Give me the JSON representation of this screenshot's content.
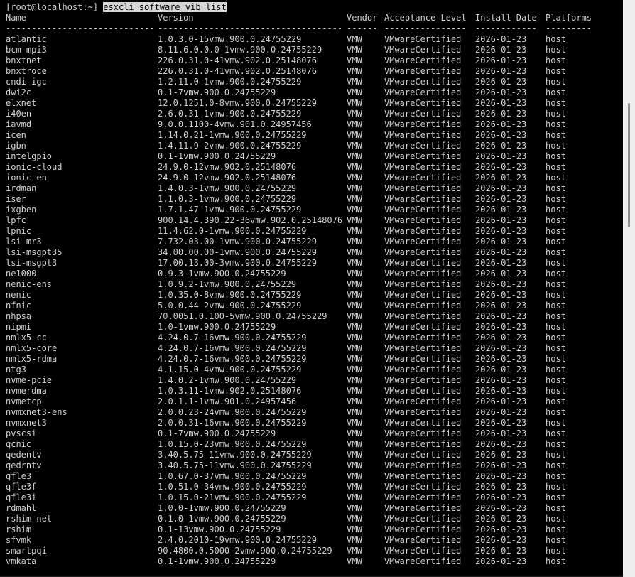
{
  "terminal": {
    "prompt": "[root@localhost:~] ",
    "command": "esxcli software vib list"
  },
  "table": {
    "headers": [
      "Name",
      "Version",
      "Vendor",
      "Acceptance Level",
      "Install Date",
      "Platforms"
    ],
    "separators": [
      "-----------------------------",
      "------------------------------------",
      "------",
      "----------------",
      "------------",
      "---------"
    ],
    "rows": [
      [
        "atlantic",
        "1.0.3.0-15vmw.900.0.24755229",
        "VMW",
        "VMwareCertified",
        "2026-01-23",
        "host"
      ],
      [
        "bcm-mpi3",
        "8.11.6.0.0.0-1vmw.900.0.24755229",
        "VMW",
        "VMwareCertified",
        "2026-01-23",
        "host"
      ],
      [
        "bnxtnet",
        "226.0.31.0-41vmw.902.0.25148076",
        "VMW",
        "VMwareCertified",
        "2026-01-23",
        "host"
      ],
      [
        "bnxtroce",
        "226.0.31.0-41vmw.902.0.25148076",
        "VMW",
        "VMwareCertified",
        "2026-01-23",
        "host"
      ],
      [
        "cndi-igc",
        "1.2.11.0-1vmw.900.0.24755229",
        "VMW",
        "VMwareCertified",
        "2026-01-23",
        "host"
      ],
      [
        "dwi2c",
        "0.1-7vmw.900.0.24755229",
        "VMW",
        "VMwareCertified",
        "2026-01-23",
        "host"
      ],
      [
        "elxnet",
        "12.0.1251.0-8vmw.900.0.24755229",
        "VMW",
        "VMwareCertified",
        "2026-01-23",
        "host"
      ],
      [
        "i40en",
        "2.6.0.31-1vmw.900.0.24755229",
        "VMW",
        "VMwareCertified",
        "2026-01-23",
        "host"
      ],
      [
        "iavmd",
        "9.0.0.1100-4vmw.901.0.24957456",
        "VMW",
        "VMwareCertified",
        "2026-01-23",
        "host"
      ],
      [
        "icen",
        "1.14.0.21-1vmw.900.0.24755229",
        "VMW",
        "VMwareCertified",
        "2026-01-23",
        "host"
      ],
      [
        "igbn",
        "1.4.11.9-2vmw.900.0.24755229",
        "VMW",
        "VMwareCertified",
        "2026-01-23",
        "host"
      ],
      [
        "intelgpio",
        "0.1-1vmw.900.0.24755229",
        "VMW",
        "VMwareCertified",
        "2026-01-23",
        "host"
      ],
      [
        "ionic-cloud",
        "24.9.0-12vmw.902.0.25148076",
        "VMW",
        "VMwareCertified",
        "2026-01-23",
        "host"
      ],
      [
        "ionic-en",
        "24.9.0-12vmw.902.0.25148076",
        "VMW",
        "VMwareCertified",
        "2026-01-23",
        "host"
      ],
      [
        "irdman",
        "1.4.0.3-1vmw.900.0.24755229",
        "VMW",
        "VMwareCertified",
        "2026-01-23",
        "host"
      ],
      [
        "iser",
        "1.1.0.3-1vmw.900.0.24755229",
        "VMW",
        "VMwareCertified",
        "2026-01-23",
        "host"
      ],
      [
        "ixgben",
        "1.7.1.47-1vmw.900.0.24755229",
        "VMW",
        "VMwareCertified",
        "2026-01-23",
        "host"
      ],
      [
        "lpfc",
        "900.14.4.390.22-36vmw.902.0.25148076",
        "VMW",
        "VMwareCertified",
        "2026-01-23",
        "host"
      ],
      [
        "lpnic",
        "11.4.62.0-1vmw.900.0.24755229",
        "VMW",
        "VMwareCertified",
        "2026-01-23",
        "host"
      ],
      [
        "lsi-mr3",
        "7.732.03.00-1vmw.900.0.24755229",
        "VMW",
        "VMwareCertified",
        "2026-01-23",
        "host"
      ],
      [
        "lsi-msgpt35",
        "34.00.00.00-1vmw.900.0.24755229",
        "VMW",
        "VMwareCertified",
        "2026-01-23",
        "host"
      ],
      [
        "lsi-msgpt3",
        "17.00.13.00-3vmw.900.0.24755229",
        "VMW",
        "VMwareCertified",
        "2026-01-23",
        "host"
      ],
      [
        "ne1000",
        "0.9.3-1vmw.900.0.24755229",
        "VMW",
        "VMwareCertified",
        "2026-01-23",
        "host"
      ],
      [
        "nenic-ens",
        "1.0.9.2-1vmw.900.0.24755229",
        "VMW",
        "VMwareCertified",
        "2026-01-23",
        "host"
      ],
      [
        "nenic",
        "1.0.35.0-8vmw.900.0.24755229",
        "VMW",
        "VMwareCertified",
        "2026-01-23",
        "host"
      ],
      [
        "nfnic",
        "5.0.0.44-2vmw.900.0.24755229",
        "VMW",
        "VMwareCertified",
        "2026-01-23",
        "host"
      ],
      [
        "nhpsa",
        "70.0051.0.100-5vmw.900.0.24755229",
        "VMW",
        "VMwareCertified",
        "2026-01-23",
        "host"
      ],
      [
        "nipmi",
        "1.0-1vmw.900.0.24755229",
        "VMW",
        "VMwareCertified",
        "2026-01-23",
        "host"
      ],
      [
        "nmlx5-cc",
        "4.24.0.7-16vmw.900.0.24755229",
        "VMW",
        "VMwareCertified",
        "2026-01-23",
        "host"
      ],
      [
        "nmlx5-core",
        "4.24.0.7-16vmw.900.0.24755229",
        "VMW",
        "VMwareCertified",
        "2026-01-23",
        "host"
      ],
      [
        "nmlx5-rdma",
        "4.24.0.7-16vmw.900.0.24755229",
        "VMW",
        "VMwareCertified",
        "2026-01-23",
        "host"
      ],
      [
        "ntg3",
        "4.1.15.0-4vmw.900.0.24755229",
        "VMW",
        "VMwareCertified",
        "2026-01-23",
        "host"
      ],
      [
        "nvme-pcie",
        "1.4.0.2-1vmw.900.0.24755229",
        "VMW",
        "VMwareCertified",
        "2026-01-23",
        "host"
      ],
      [
        "nvmerdma",
        "1.0.3.11-1vmw.902.0.25148076",
        "VMW",
        "VMwareCertified",
        "2026-01-23",
        "host"
      ],
      [
        "nvmetcp",
        "2.0.1.1-1vmw.901.0.24957456",
        "VMW",
        "VMwareCertified",
        "2026-01-23",
        "host"
      ],
      [
        "nvmxnet3-ens",
        "2.0.0.23-24vmw.900.0.24755229",
        "VMW",
        "VMwareCertified",
        "2026-01-23",
        "host"
      ],
      [
        "nvmxnet3",
        "2.0.0.31-16vmw.900.0.24755229",
        "VMW",
        "VMwareCertified",
        "2026-01-23",
        "host"
      ],
      [
        "pvscsi",
        "0.1-7vmw.900.0.24755229",
        "VMW",
        "VMwareCertified",
        "2026-01-23",
        "host"
      ],
      [
        "qcnic",
        "1.0.15.0-23vmw.900.0.24755229",
        "VMW",
        "VMwareCertified",
        "2026-01-23",
        "host"
      ],
      [
        "qedentv",
        "3.40.5.75-11vmw.900.0.24755229",
        "VMW",
        "VMwareCertified",
        "2026-01-23",
        "host"
      ],
      [
        "qedrntv",
        "3.40.5.75-11vmw.900.0.24755229",
        "VMW",
        "VMwareCertified",
        "2026-01-23",
        "host"
      ],
      [
        "qfle3",
        "1.0.67.0-37vmw.900.0.24755229",
        "VMW",
        "VMwareCertified",
        "2026-01-23",
        "host"
      ],
      [
        "qfle3f",
        "1.0.51.0-34vmw.900.0.24755229",
        "VMW",
        "VMwareCertified",
        "2026-01-23",
        "host"
      ],
      [
        "qfle3i",
        "1.0.15.0-21vmw.900.0.24755229",
        "VMW",
        "VMwareCertified",
        "2026-01-23",
        "host"
      ],
      [
        "rdmahl",
        "1.0.0-1vmw.900.0.24755229",
        "VMW",
        "VMwareCertified",
        "2026-01-23",
        "host"
      ],
      [
        "rshim-net",
        "0.1.0-1vmw.900.0.24755229",
        "VMW",
        "VMwareCertified",
        "2026-01-23",
        "host"
      ],
      [
        "rshim",
        "0.1-13vmw.900.0.24755229",
        "VMW",
        "VMwareCertified",
        "2026-01-23",
        "host"
      ],
      [
        "sfvmk",
        "2.4.0.2010-19vmw.900.0.24755229",
        "VMW",
        "VMwareCertified",
        "2026-01-23",
        "host"
      ],
      [
        "smartpqi",
        "90.4800.0.5000-2vmw.900.0.24755229",
        "VMW",
        "VMwareCertified",
        "2026-01-23",
        "host"
      ],
      [
        "vmkata",
        "0.1-1vmw.900.0.24755229",
        "VMW",
        "VMwareCertified",
        "2026-01-23",
        "host"
      ]
    ]
  },
  "colors": {
    "background": "#000000",
    "text": "#cfcfcf",
    "highlight_bg": "#d6d6d6",
    "highlight_text": "#000000",
    "scrollbar_track": "#ededed",
    "scrollbar_thumb": "#8f8f8f"
  }
}
